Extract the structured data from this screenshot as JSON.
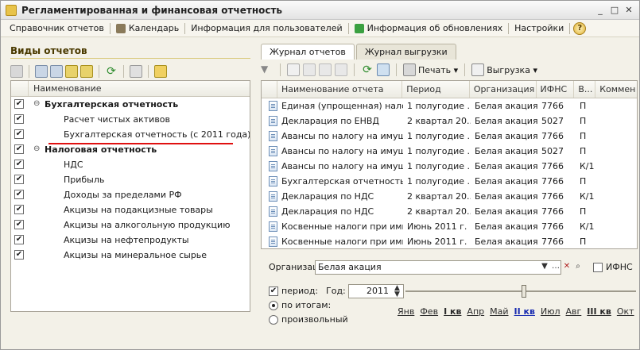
{
  "window": {
    "title": "Регламентированная и финансовая отчетность"
  },
  "menu": [
    {
      "label": "Справочник отчетов",
      "icon": ""
    },
    {
      "label": "Календарь",
      "icon": "calendar-icon"
    },
    {
      "label": "Информация для пользователей",
      "icon": ""
    },
    {
      "label": "Информация об обновлениях",
      "icon": "update-icon"
    },
    {
      "label": "Настройки",
      "icon": ""
    }
  ],
  "left": {
    "title": "Виды отчетов",
    "column": "Наименование",
    "tree": [
      {
        "label": "Бухгалтерская отчетность",
        "group": true,
        "checked": true
      },
      {
        "label": "Расчет чистых активов",
        "group": false,
        "checked": true
      },
      {
        "label": "Бухгалтерская отчетность (с 2011 года)",
        "group": false,
        "checked": true
      },
      {
        "label": "Налоговая отчетность",
        "group": true,
        "checked": true
      },
      {
        "label": "НДС",
        "group": false,
        "checked": true
      },
      {
        "label": "Прибыль",
        "group": false,
        "checked": true
      },
      {
        "label": "Доходы за пределами РФ",
        "group": false,
        "checked": true
      },
      {
        "label": "Акцизы на подакцизные товары",
        "group": false,
        "checked": true
      },
      {
        "label": "Акцизы на алкогольную продукцию",
        "group": false,
        "checked": true
      },
      {
        "label": "Акцизы на нефтепродукты",
        "group": false,
        "checked": true
      },
      {
        "label": "Акцизы на минеральное сырье",
        "group": false,
        "checked": true
      }
    ]
  },
  "right": {
    "tabs": [
      "Журнал отчетов",
      "Журнал выгрузки"
    ],
    "toolbar": {
      "print": "Печать",
      "export": "Выгрузка"
    },
    "columns": [
      "Наименование отчета",
      "Период",
      "Организация",
      "ИФНС",
      "В...",
      "Коммен"
    ],
    "rows": [
      [
        "Единая (упрощенная) налог...",
        "1 полугодие ...",
        "Белая акация",
        "7766",
        "П"
      ],
      [
        "Декларация по ЕНВД",
        "2 квартал 20...",
        "Белая акация",
        "5027",
        "П"
      ],
      [
        "Авансы по налогу на имущ...",
        "1 полугодие ...",
        "Белая акация",
        "7766",
        "П"
      ],
      [
        "Авансы по налогу на имущ...",
        "1 полугодие ...",
        "Белая акация",
        "5027",
        "П"
      ],
      [
        "Авансы по налогу на имущ...",
        "1 полугодие ...",
        "Белая акация",
        "7766",
        "К/1"
      ],
      [
        "Бухгалтерская отчетность (...",
        "1 полугодие ...",
        "Белая акация",
        "7766",
        "П"
      ],
      [
        "Декларация по НДС",
        "2 квартал 20...",
        "Белая акация",
        "7766",
        "К/1"
      ],
      [
        "Декларация по НДС",
        "2 квартал 20...",
        "Белая акация",
        "7766",
        "П"
      ],
      [
        "Косвенные налоги при имп...",
        "Июнь 2011 г.",
        "Белая акация",
        "7766",
        "К/1"
      ],
      [
        "Косвенные налоги при имп...",
        "Июнь 2011 г.",
        "Белая акация",
        "7766",
        "П"
      ]
    ],
    "filter": {
      "org_label": "Организация:",
      "org_value": "Белая акация",
      "ifns_label": "ИФНС",
      "period_label": "период:",
      "year_label": "Год:",
      "year_value": "2011",
      "by_totals": "по итогам:",
      "arbitrary": "произвольный",
      "months": [
        "Янв",
        "Фев",
        "I кв",
        "Апр",
        "Май",
        "II кв",
        "Июл",
        "Авг",
        "III кв",
        "Окт"
      ]
    }
  }
}
